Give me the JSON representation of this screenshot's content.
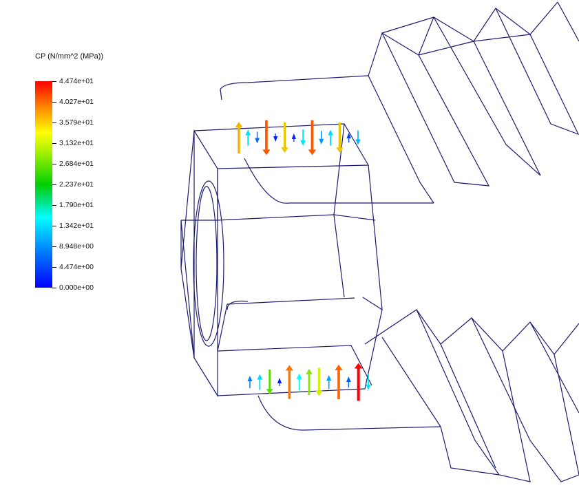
{
  "legend": {
    "title": "CP (N/mm^2 (MPa))",
    "ticks": [
      "4.474e+01",
      "4.027e+01",
      "3.579e+01",
      "3.132e+01",
      "2.684e+01",
      "2.237e+01",
      "1.790e+01",
      "1.342e+01",
      "8.948e+00",
      "4.474e+00",
      "0.000e+00"
    ]
  },
  "colors": {
    "wireframe": "#1a1a6e",
    "max": "#ff0000",
    "orange": "#ff8c00",
    "yellow": "#e6e600",
    "green": "#40b000",
    "cyan": "#00d0e0",
    "blue": "#0070ff",
    "min": "#0000ff"
  },
  "vectors_top": [
    {
      "value": 35.5,
      "dir": "up"
    },
    {
      "value": 13.0,
      "dir": "up"
    },
    {
      "value": 7.0,
      "dir": "down"
    },
    {
      "value": 40.5,
      "dir": "down"
    },
    {
      "value": 2.0,
      "dir": "down"
    },
    {
      "value": 34.0,
      "dir": "down"
    },
    {
      "value": 2.0,
      "dir": "up"
    },
    {
      "value": 13.5,
      "dir": "down"
    },
    {
      "value": 40.5,
      "dir": "down"
    },
    {
      "value": 9.5,
      "dir": "down"
    },
    {
      "value": 13.0,
      "dir": "up"
    },
    {
      "value": 34.0,
      "dir": "down"
    },
    {
      "value": 4.0,
      "dir": "up"
    },
    {
      "value": 11.0,
      "dir": "down"
    }
  ],
  "vectors_bottom": [
    {
      "value": 8.0,
      "dir": "up"
    },
    {
      "value": 13.0,
      "dir": "up"
    },
    {
      "value": 26.0,
      "dir": "down"
    },
    {
      "value": 2.0,
      "dir": "up"
    },
    {
      "value": 39.0,
      "dir": "up"
    },
    {
      "value": 14.5,
      "dir": "up"
    },
    {
      "value": 28.0,
      "dir": "up"
    },
    {
      "value": 31.0,
      "dir": "down"
    },
    {
      "value": 10.0,
      "dir": "up"
    },
    {
      "value": 40.0,
      "dir": "up"
    },
    {
      "value": 6.0,
      "dir": "up"
    },
    {
      "value": 44.7,
      "dir": "up"
    },
    {
      "value": 13.5,
      "dir": "down"
    }
  ]
}
